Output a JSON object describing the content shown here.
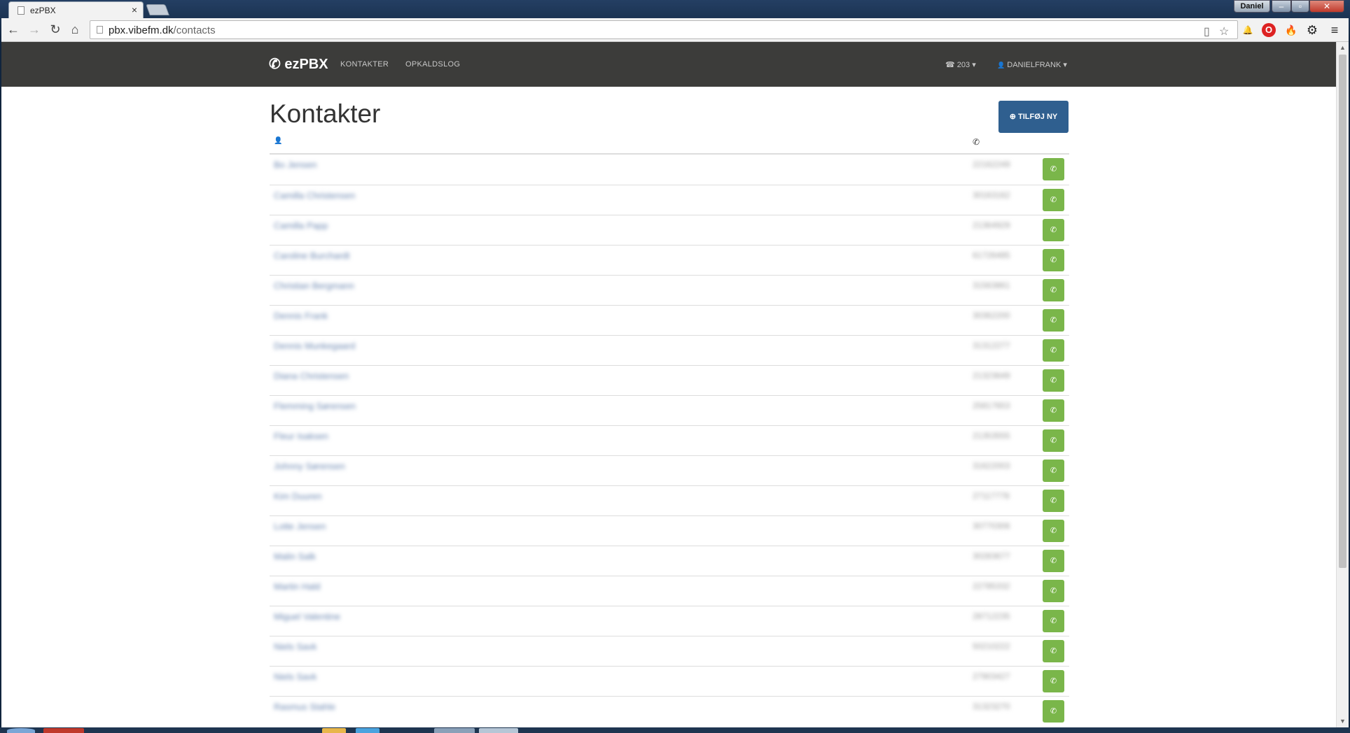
{
  "browser": {
    "tab_title": "ezPBX",
    "tab_close": "×",
    "user_badge": "Daniel",
    "window_min": "–",
    "window_max": "▫",
    "window_close": "✕",
    "url_host": "pbx.vibefm.dk",
    "url_path": "/contacts",
    "nav": {
      "back": "←",
      "forward": "→",
      "reload": "↻",
      "home": "⌂"
    },
    "icons": {
      "reader": "▯",
      "star": "☆",
      "bell": "🔔",
      "opera": "O",
      "fire": "🔥",
      "gear": "⚙",
      "menu": "≡"
    }
  },
  "app": {
    "brand_icon": "✆",
    "brand": "ezPBX",
    "nav": {
      "contacts": "KONTAKTER",
      "calllog": "OPKALDSLOG"
    },
    "extension_icon": "☎",
    "extension": "203",
    "user_icon": "👤",
    "user": "DANIELFRANK",
    "caret": "▾"
  },
  "page": {
    "title": "Kontakter",
    "add_icon": "⊕",
    "add_button": "TILFØJ NY",
    "col_name_icon": "👤",
    "col_phone_icon": "✆",
    "call_icon": "✆"
  },
  "contacts": [
    {
      "name": "Bo Jensen",
      "number": "22162249"
    },
    {
      "name": "Camilla Christensen",
      "number": "30163162"
    },
    {
      "name": "Camilla Papp",
      "number": "21364929"
    },
    {
      "name": "Caroline Burchardt",
      "number": "61726485"
    },
    {
      "name": "Christian Bergmann",
      "number": "31563861"
    },
    {
      "name": "Dennis Frank",
      "number": "30362200"
    },
    {
      "name": "Dennis Munkegaard",
      "number": "31312277"
    },
    {
      "name": "Diana Christensen",
      "number": "21323649"
    },
    {
      "name": "Flemming Sørensen",
      "number": "25817653"
    },
    {
      "name": "Fleur Isaksen",
      "number": "21353555"
    },
    {
      "name": "Johnny Sørensen",
      "number": "31622003"
    },
    {
      "name": "Kim Duuren",
      "number": "27117778"
    },
    {
      "name": "Lotte Jensen",
      "number": "30770306"
    },
    {
      "name": "Malin Salk",
      "number": "30283677"
    },
    {
      "name": "Martin Hald",
      "number": "22785332"
    },
    {
      "name": "Miguel Valentine",
      "number": "28712235"
    },
    {
      "name": "Niels Savk",
      "number": "50210222"
    },
    {
      "name": "Niels Savk",
      "number": "27903427"
    },
    {
      "name": "Rasmus Stahle",
      "number": "31323270"
    }
  ]
}
